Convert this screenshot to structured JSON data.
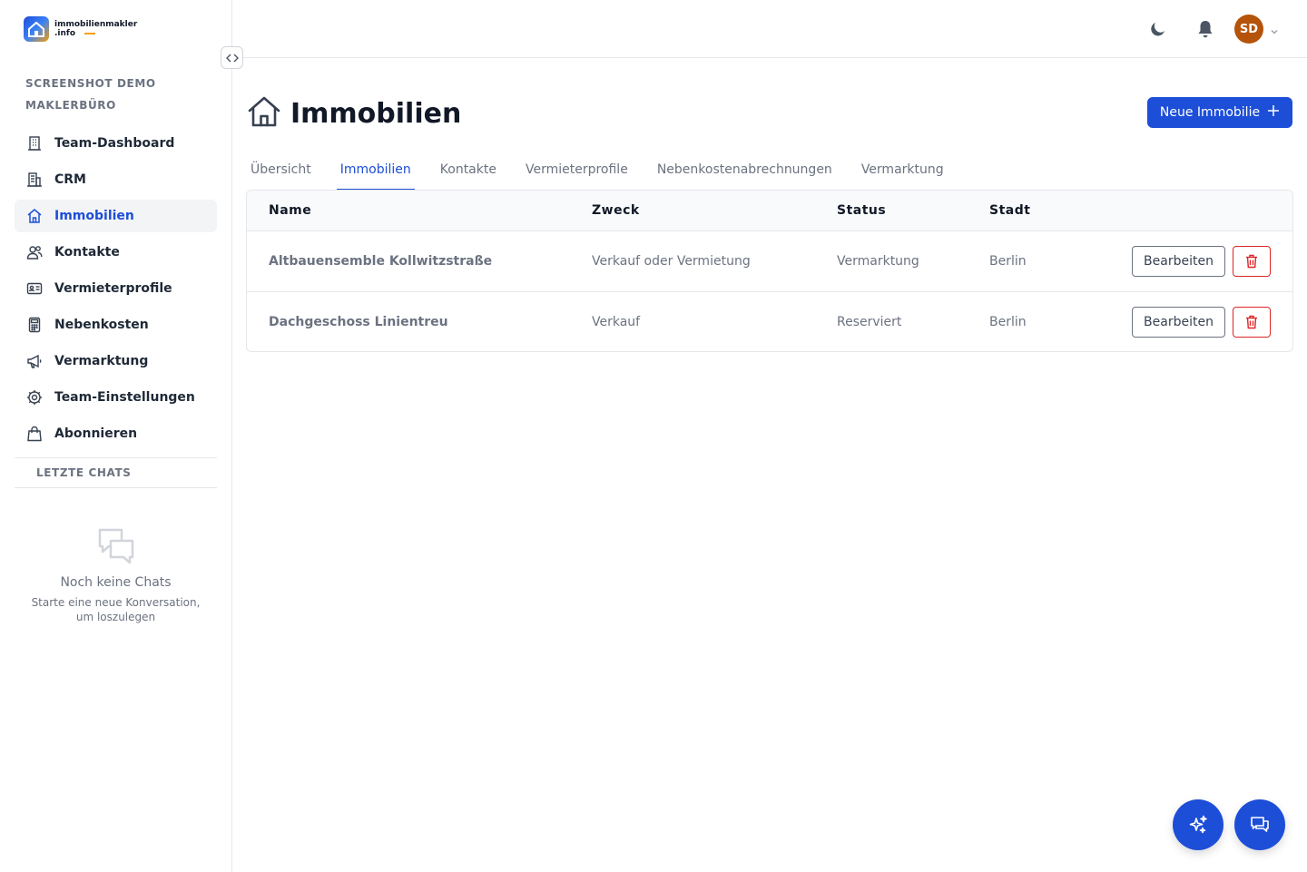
{
  "brand": {
    "name_line1": "immobilienmakler",
    "name_line2": ".info"
  },
  "organization": "SCREENSHOT DEMO MAKLERBÜRO",
  "sidebar": {
    "items": [
      {
        "label": "Team-Dashboard",
        "icon": "building-icon"
      },
      {
        "label": "CRM",
        "icon": "office-building-icon"
      },
      {
        "label": "Immobilien",
        "icon": "home-icon",
        "active": true
      },
      {
        "label": "Kontakte",
        "icon": "users-icon"
      },
      {
        "label": "Vermieterprofile",
        "icon": "id-card-icon"
      },
      {
        "label": "Nebenkosten",
        "icon": "calculator-icon"
      },
      {
        "label": "Vermarktung",
        "icon": "megaphone-icon"
      },
      {
        "label": "Team-Einstellungen",
        "icon": "gear-icon"
      },
      {
        "label": "Abonnieren",
        "icon": "shopping-bag-icon"
      }
    ],
    "chats_header": "LETZTE CHATS",
    "no_chats_title": "Noch keine Chats",
    "no_chats_subtitle": "Starte eine neue Konversation, um loszulegen"
  },
  "topbar": {
    "avatar_initials": "SD"
  },
  "page": {
    "title": "Immobilien",
    "new_button": "Neue Immobilie",
    "tabs": [
      "Übersicht",
      "Immobilien",
      "Kontakte",
      "Vermieterprofile",
      "Nebenkostenabrechnungen",
      "Vermarktung"
    ],
    "active_tab": "Immobilien"
  },
  "table": {
    "headers": [
      "Name",
      "Zweck",
      "Status",
      "Stadt"
    ],
    "rows": [
      {
        "name": "Altbauensemble Kollwitzstraße",
        "zweck": "Verkauf oder Vermietung",
        "status": "Vermarktung",
        "stadt": "Berlin"
      },
      {
        "name": "Dachgeschoss Linientreu",
        "zweck": "Verkauf",
        "status": "Reserviert",
        "stadt": "Berlin"
      }
    ],
    "edit_label": "Bearbeiten"
  },
  "colors": {
    "primary": "#1d4ed8",
    "danger": "#dc2626",
    "avatar": "#b45309"
  }
}
